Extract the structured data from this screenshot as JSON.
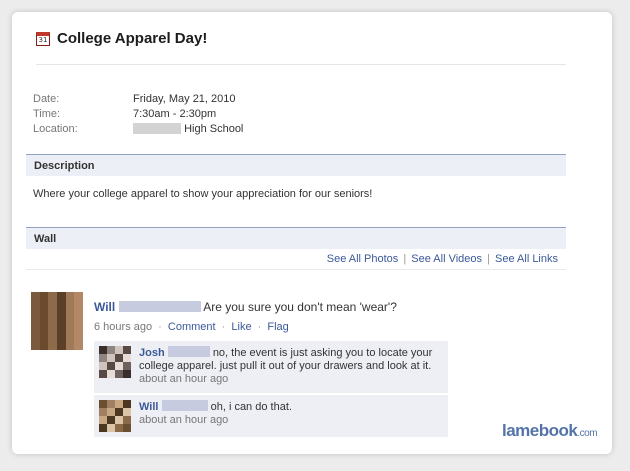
{
  "event": {
    "title": "College Apparel Day!",
    "calendar_icon_day": "31"
  },
  "info": {
    "date_label": "Date:",
    "date_value": "Friday, May 21, 2010",
    "time_label": "Time:",
    "time_value": "7:30am - 2:30pm",
    "location_label": "Location:",
    "location_value": "High School"
  },
  "description": {
    "header": "Description",
    "text": "Where your college apparel to show your appreciation for our seniors!"
  },
  "wall": {
    "header": "Wall",
    "links": [
      "See All Photos",
      "See All Videos",
      "See All Links"
    ],
    "link_separator": "|"
  },
  "post": {
    "author": "Will",
    "text": "Are you sure you don't mean 'wear'?",
    "time": "6 hours ago",
    "comment_label": "Comment",
    "like_label": "Like",
    "flag_label": "Flag",
    "meta_separator": "·"
  },
  "replies": [
    {
      "author": "Josh",
      "text_line1": "no, the event is just asking you to locate your",
      "text_line2": "college apparel. just pull it out of your drawers and look at it.",
      "time": "about an hour ago"
    },
    {
      "author": "Will",
      "text_line1": "oh, i can do that.",
      "time": "about an hour ago"
    }
  ],
  "watermark": {
    "brand": "lamebook",
    "suffix": ".com"
  },
  "colors": {
    "link": "#3b5998",
    "section_bg": "#eceff5",
    "section_border": "#94a3c4",
    "reply_bg": "#edeff4"
  }
}
